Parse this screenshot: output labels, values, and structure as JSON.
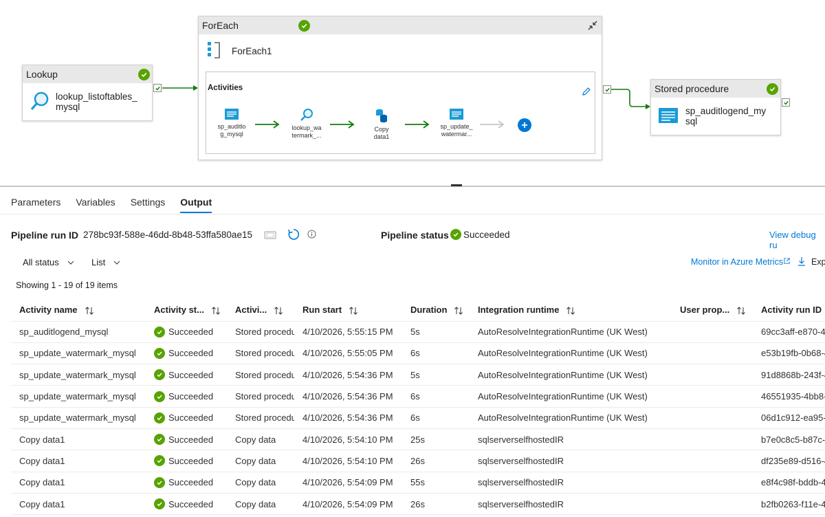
{
  "canvas": {
    "lookup": {
      "type_label": "Lookup",
      "name": "lookup_listoftables_\nmysql"
    },
    "foreach": {
      "type_label": "ForEach",
      "name": "ForEach1",
      "activities_label": "Activities",
      "inner": [
        {
          "name": "sp_auditlo\ng_mysql",
          "icon": "stored-procedure-icon"
        },
        {
          "name": "lookup_wa\ntermark_...",
          "icon": "lookup-icon"
        },
        {
          "name": "Copy\ndata1",
          "icon": "copy-data-icon"
        },
        {
          "name": "sp_update_\nwatermar...",
          "icon": "stored-procedure-icon"
        }
      ]
    },
    "stored_proc": {
      "type_label": "Stored procedure",
      "name": "sp_auditlogend_my\nsql"
    }
  },
  "tabs": [
    {
      "label": "Parameters",
      "active": false
    },
    {
      "label": "Variables",
      "active": false
    },
    {
      "label": "Settings",
      "active": false
    },
    {
      "label": "Output",
      "active": true
    }
  ],
  "run": {
    "run_id_label": "Pipeline run ID",
    "run_id": "278bc93f-588e-46dd-8b48-53ffa580ae15",
    "status_label": "Pipeline status",
    "status": "Succeeded",
    "view_debug_link": "View debug ru",
    "monitor_link": "Monitor in Azure Metrics",
    "export_label": "Exp"
  },
  "filters": {
    "status": "All status",
    "view": "List"
  },
  "showing": "Showing 1 - 19 of 19 items",
  "table": {
    "columns": [
      "Activity name",
      "Activity st...",
      "Activi...",
      "Run start",
      "Duration",
      "Integration runtime",
      "User prop...",
      "Activity run ID"
    ],
    "rows": [
      [
        "sp_auditlogend_mysql",
        "Succeeded",
        "Stored procedu",
        "4/10/2026, 5:55:15 PM",
        "5s",
        "AutoResolveIntegrationRuntime (UK West)",
        "",
        "69cc3aff-e870-4"
      ],
      [
        "sp_update_watermark_mysql",
        "Succeeded",
        "Stored procedu",
        "4/10/2026, 5:55:05 PM",
        "6s",
        "AutoResolveIntegrationRuntime (UK West)",
        "",
        "e53b19fb-0b68-4"
      ],
      [
        "sp_update_watermark_mysql",
        "Succeeded",
        "Stored procedu",
        "4/10/2026, 5:54:36 PM",
        "5s",
        "AutoResolveIntegrationRuntime (UK West)",
        "",
        "91d8868b-243f-4"
      ],
      [
        "sp_update_watermark_mysql",
        "Succeeded",
        "Stored procedu",
        "4/10/2026, 5:54:36 PM",
        "6s",
        "AutoResolveIntegrationRuntime (UK West)",
        "",
        "46551935-4bb8-4"
      ],
      [
        "sp_update_watermark_mysql",
        "Succeeded",
        "Stored procedu",
        "4/10/2026, 5:54:36 PM",
        "6s",
        "AutoResolveIntegrationRuntime (UK West)",
        "",
        "06d1c912-ea95-4"
      ],
      [
        "Copy data1",
        "Succeeded",
        "Copy data",
        "4/10/2026, 5:54:10 PM",
        "25s",
        "sqlserverselfhostedIR",
        "",
        "b7e0c8c5-b87c-4"
      ],
      [
        "Copy data1",
        "Succeeded",
        "Copy data",
        "4/10/2026, 5:54:10 PM",
        "26s",
        "sqlserverselfhostedIR",
        "",
        "df235e89-d516-4"
      ],
      [
        "Copy data1",
        "Succeeded",
        "Copy data",
        "4/10/2026, 5:54:09 PM",
        "55s",
        "sqlserverselfhostedIR",
        "",
        "e8f4c98f-bddb-4"
      ],
      [
        "Copy data1",
        "Succeeded",
        "Copy data",
        "4/10/2026, 5:54:09 PM",
        "26s",
        "sqlserverselfhostedIR",
        "",
        "b2fb0263-f11e-4"
      ]
    ]
  },
  "colors": {
    "accent": "#0078d4",
    "success": "#57a300",
    "arrow": "#107c10"
  }
}
